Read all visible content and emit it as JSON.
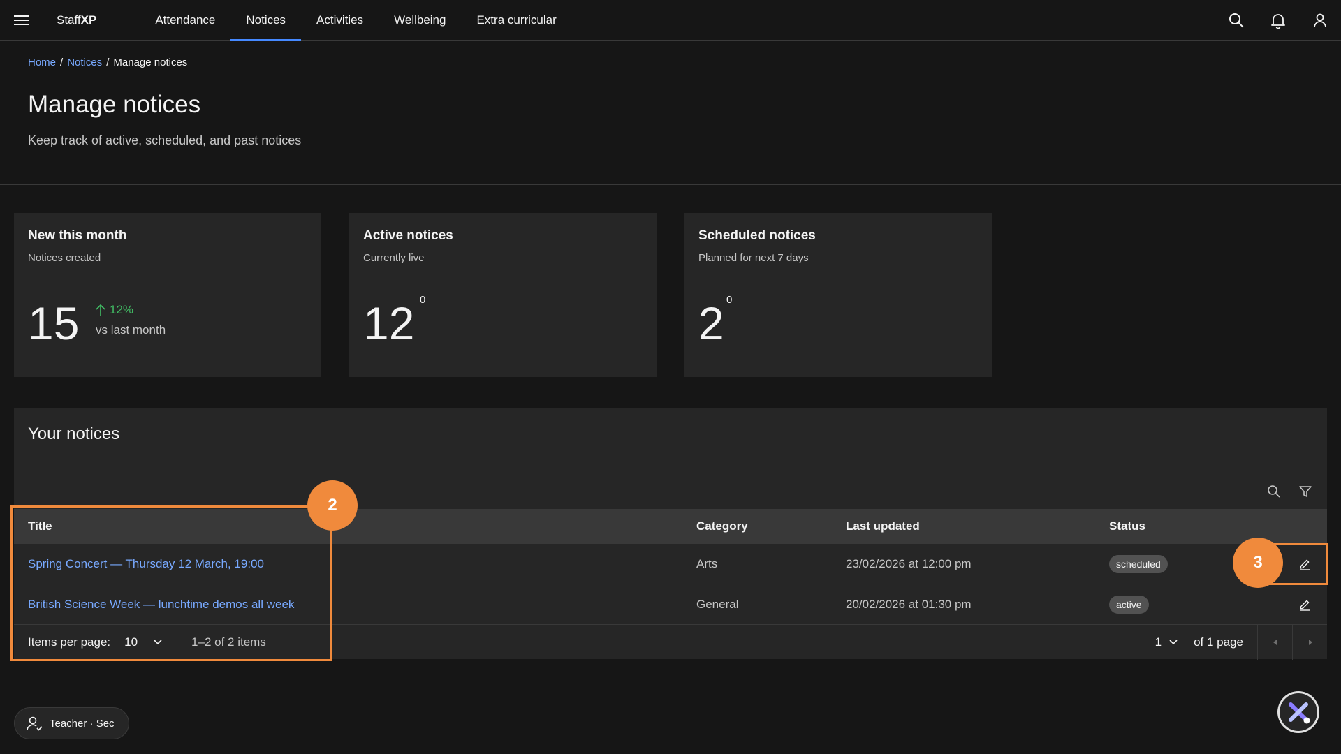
{
  "header": {
    "brand_prefix": "Staff",
    "brand_suffix": "XP",
    "nav": [
      {
        "label": "Attendance"
      },
      {
        "label": "Notices"
      },
      {
        "label": "Activities"
      },
      {
        "label": "Wellbeing"
      },
      {
        "label": "Extra curricular"
      }
    ],
    "active_nav": "Notices",
    "icons": [
      "menu-icon",
      "search-icon",
      "bell-icon",
      "user-icon"
    ]
  },
  "breadcrumb": {
    "items": [
      "Home",
      "Notices"
    ],
    "current": "Manage notices",
    "separator": "/"
  },
  "page": {
    "title": "Manage notices",
    "subtitle": "Keep track of active, scheduled, and past notices"
  },
  "stats": [
    {
      "title": "New this month",
      "subtitle": "Notices created",
      "value": "15",
      "trend": "12%",
      "trend_note": "vs last month",
      "trend_color": "#42be65"
    },
    {
      "title": "Active notices",
      "subtitle": "Currently live",
      "value": "12",
      "sup": "0"
    },
    {
      "title": "Scheduled notices",
      "subtitle": "Planned for next 7 days",
      "value": "2",
      "sup": "0"
    }
  ],
  "notices": {
    "title": "Your notices",
    "columns": [
      "Title",
      "Category",
      "Last updated",
      "Status"
    ],
    "rows": [
      {
        "title": "Spring Concert — Thursday 12 March, 19:00",
        "category": "Arts",
        "updated": "23/02/2026 at 12:00 pm",
        "status": "scheduled"
      },
      {
        "title": "British Science Week — lunchtime demos all week",
        "category": "General",
        "updated": "20/02/2026 at 01:30 pm",
        "status": "active"
      }
    ],
    "pagination": {
      "items_per_page_label": "Items per page:",
      "items_per_page": "10",
      "range": "1–2 of 2 items",
      "page": "1",
      "page_total": "of 1 page"
    }
  },
  "annotations": {
    "badge_a": "2",
    "badge_b": "3",
    "color": "#f08a3c"
  },
  "footer": {
    "role": "Teacher · Sec"
  },
  "colors": {
    "accent": "#4589ff",
    "link": "#78a9ff",
    "background": "#161616",
    "surface": "#262626"
  }
}
